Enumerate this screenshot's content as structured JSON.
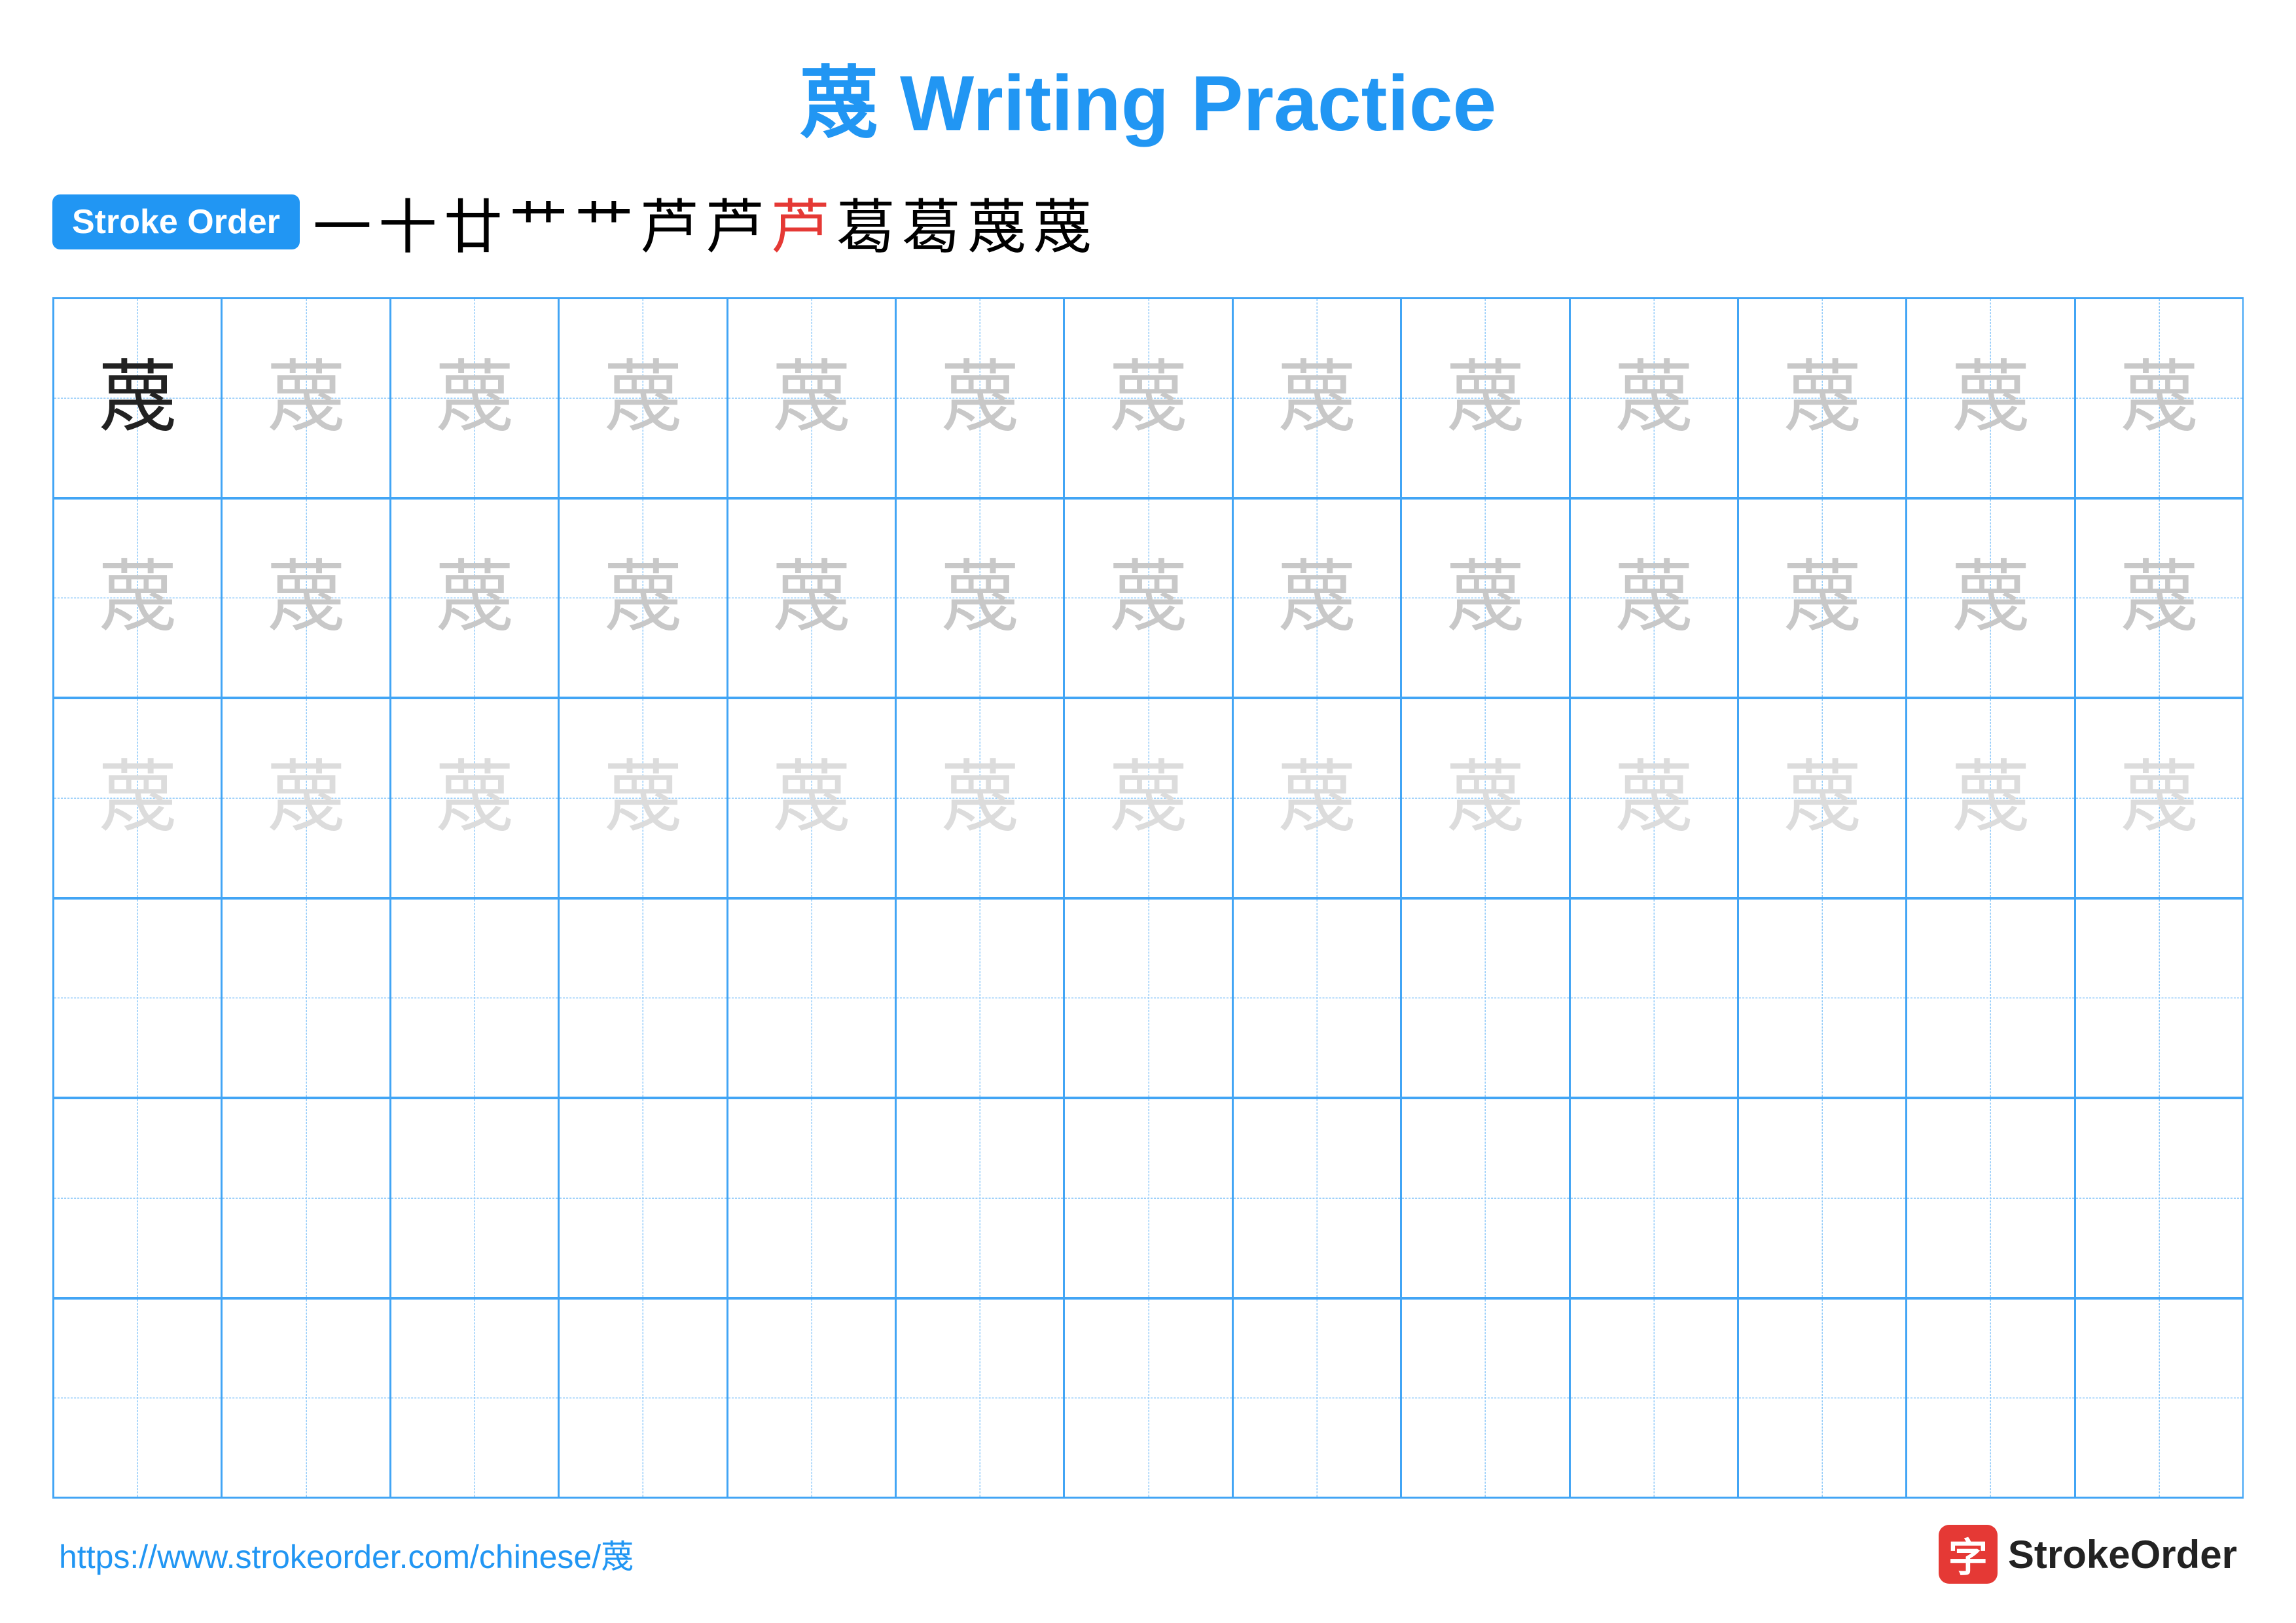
{
  "title": {
    "char": "蔑",
    "text": "Writing Practice",
    "full": "蔑 Writing Practice"
  },
  "stroke_order": {
    "badge_label": "Stroke Order",
    "strokes": [
      "一",
      "十",
      "廿",
      "艹",
      "艹",
      "芦",
      "芦",
      "芦",
      "葛",
      "葛",
      "蔑",
      "蔑"
    ]
  },
  "grid": {
    "rows": 6,
    "cols": 13,
    "character": "蔑",
    "row_types": [
      "solid_then_faint",
      "faint",
      "very_faint",
      "empty",
      "empty",
      "empty"
    ]
  },
  "footer": {
    "url": "https://www.strokeorder.com/chinese/蔑",
    "logo_char": "字",
    "logo_text": "StrokeOrder"
  }
}
